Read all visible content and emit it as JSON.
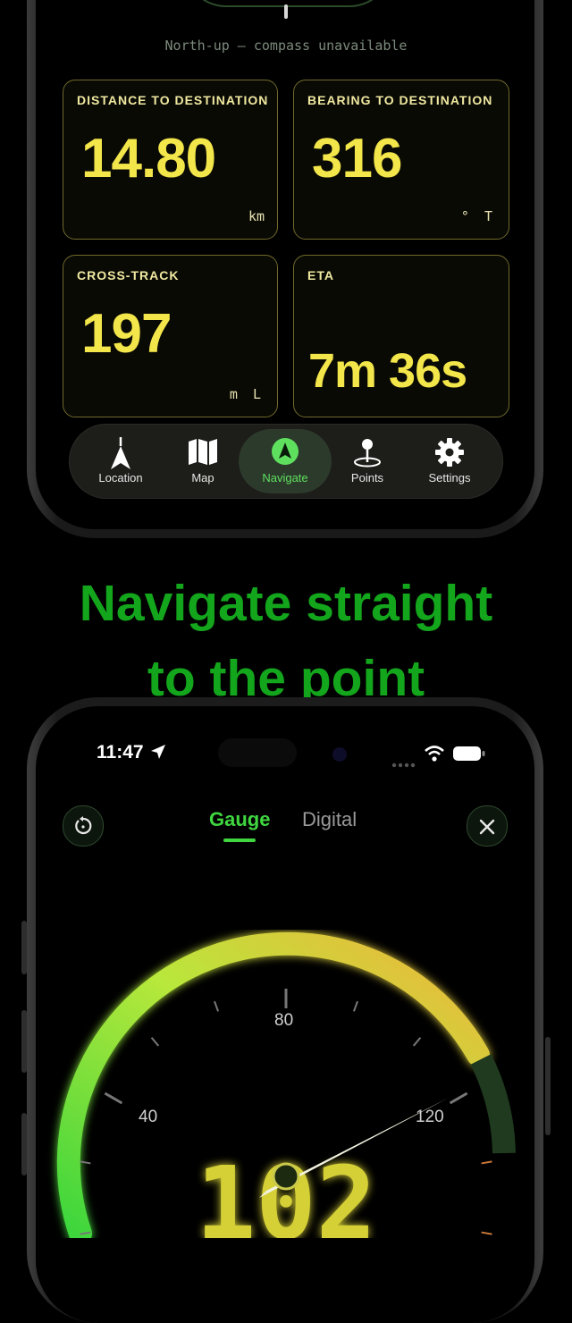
{
  "top_screen": {
    "compass_note": "North-up — compass unavailable",
    "cards": [
      {
        "label": "DISTANCE TO DESTINATION",
        "value": "14.80",
        "unit": "km"
      },
      {
        "label": "BEARING TO DESTINATION",
        "value": "316",
        "unit": "° T"
      },
      {
        "label": "CROSS-TRACK",
        "value": "197",
        "unit": "m L"
      },
      {
        "label": "ETA",
        "value": "7m 36s",
        "unit": ""
      }
    ],
    "tabs": [
      {
        "label": "Location",
        "icon": "location-arrow-icon"
      },
      {
        "label": "Map",
        "icon": "map-icon"
      },
      {
        "label": "Navigate",
        "icon": "navigate-icon",
        "active": true
      },
      {
        "label": "Points",
        "icon": "pin-icon"
      },
      {
        "label": "Settings",
        "icon": "gear-icon"
      }
    ]
  },
  "headline": {
    "line1": "Navigate straight",
    "line2": "to the point"
  },
  "bottom_screen": {
    "status_time": "11:47",
    "mode_tabs": [
      {
        "label": "Gauge",
        "active": true
      },
      {
        "label": "Digital",
        "active": false
      }
    ],
    "gauge": {
      "scale_labels": [
        "40",
        "80",
        "120"
      ],
      "digital_readout": "102"
    }
  },
  "colors": {
    "accent_green": "#13a51c",
    "card_yellow": "#f3e64a",
    "active_tab": "#5ee05e"
  }
}
